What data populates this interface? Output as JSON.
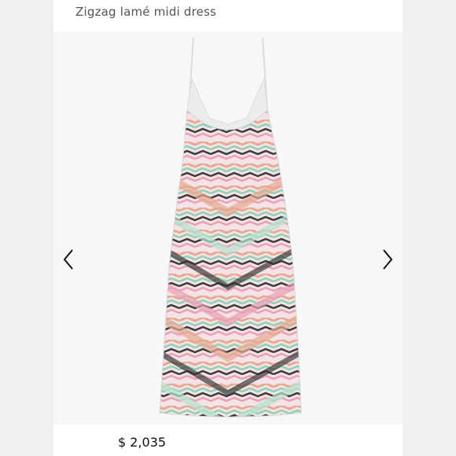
{
  "product": {
    "title": "Zigzag lamé midi dress",
    "price": "$ 2,035"
  },
  "icons": {
    "prev": "chevron-left-icon",
    "next": "chevron-right-icon"
  },
  "colors": {
    "page_bg": "#f0f0f0",
    "card_bg": "#ffffff",
    "image_bg": "#f7f7f7"
  }
}
